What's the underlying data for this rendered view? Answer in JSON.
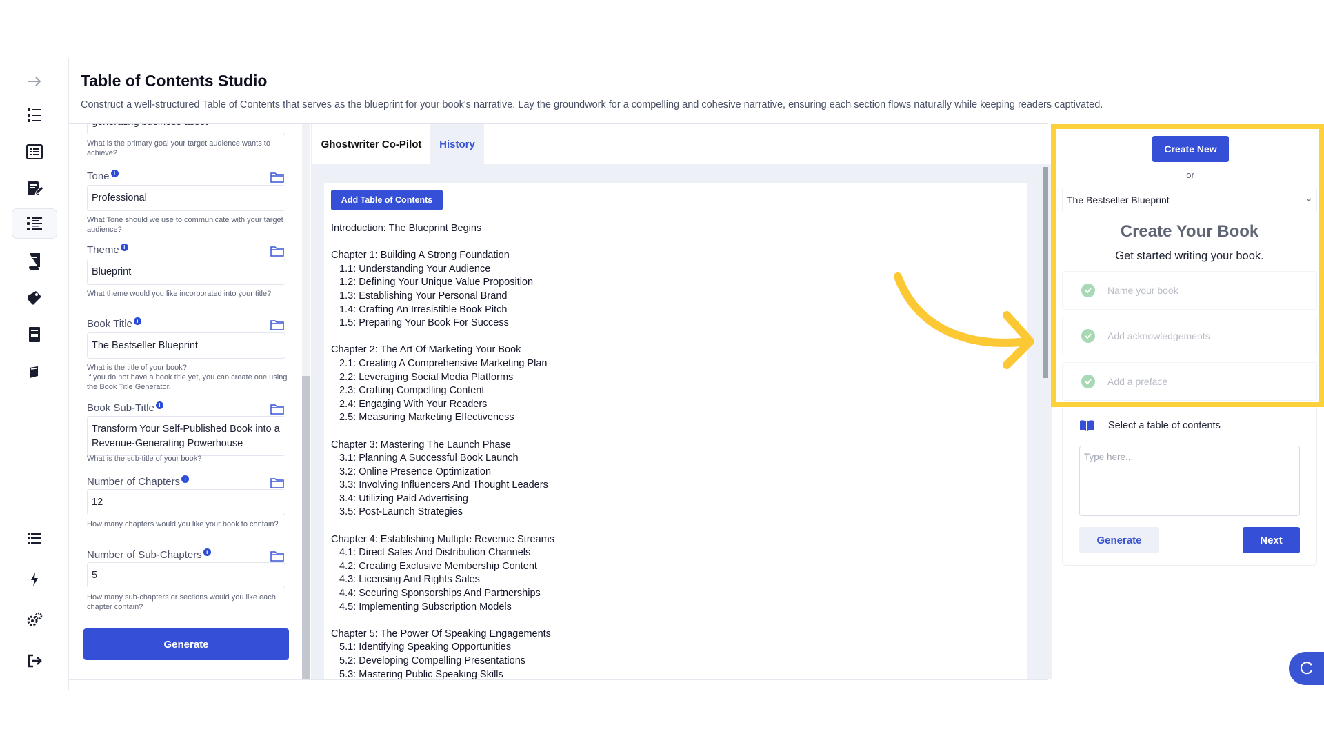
{
  "header": {
    "title": "Table of Contents Studio",
    "description": "Construct a well-structured Table of Contents that serves as the blueprint for your book's narrative. Lay the groundwork for a compelling and cohesive narrative, ensuring each section flows naturally while keeping readers captivated."
  },
  "sidebar": {
    "icons": [
      "arrow-right-icon",
      "numbered-list-icon",
      "document-list-icon",
      "edit-document-icon",
      "table-of-contents-icon",
      "book-stack-icon",
      "book-tag-icon",
      "archive-book-icon",
      "closed-book-icon",
      "list-icon",
      "lightning-icon",
      "settings-icon",
      "logout-icon"
    ]
  },
  "form": {
    "top_partial_value": "generating business asset",
    "top_help": "What is the primary goal your target audience wants to achieve?",
    "fields": [
      {
        "label": "Tone",
        "value": "Professional",
        "help": "What Tone should we use to communicate with your target audience?"
      },
      {
        "label": "Theme",
        "value": "Blueprint",
        "help": "What theme would you like incorporated into your title?"
      },
      {
        "label": "Book Title",
        "value": "The Bestseller Blueprint",
        "help": "What is the title of your book?\nIf you do not have a book title yet, you can create one using the Book Title Generator."
      },
      {
        "label": "Book Sub-Title",
        "value": "Transform Your Self-Published Book into a Revenue-Generating Powerhouse",
        "help": "What is the sub-title of your book?"
      },
      {
        "label": "Number of Chapters",
        "value": "12",
        "help": "How many chapters would you like your book to contain?"
      },
      {
        "label": "Number of Sub-Chapters",
        "value": "5",
        "help": "How many sub-chapters or sections would you like each chapter contain?"
      }
    ],
    "info_glyph": "i",
    "generate_label": "Generate"
  },
  "center": {
    "tabs": [
      "Ghostwriter Co-Pilot",
      "History"
    ],
    "add_toc_label": "Add Table of Contents",
    "intro": "Introduction: The Blueprint Begins",
    "chapters": [
      {
        "title": "Chapter 1: Building A Strong Foundation",
        "subs": [
          "1.1: Understanding Your Audience",
          "1.2: Defining Your Unique Value Proposition",
          "1.3: Establishing Your Personal Brand",
          "1.4: Crafting An Irresistible Book Pitch",
          "1.5: Preparing Your Book For Success"
        ]
      },
      {
        "title": "Chapter 2: The Art Of Marketing Your Book",
        "subs": [
          "2.1: Creating A Comprehensive Marketing Plan",
          "2.2: Leveraging Social Media Platforms",
          "2.3: Crafting Compelling Content",
          "2.4: Engaging With Your Readers",
          "2.5: Measuring Marketing Effectiveness"
        ]
      },
      {
        "title": "Chapter 3: Mastering The Launch Phase",
        "subs": [
          "3.1: Planning A Successful Book Launch",
          "3.2: Online Presence Optimization",
          "3.3: Involving Influencers And Thought Leaders",
          "3.4: Utilizing Paid Advertising",
          "3.5: Post-Launch Strategies"
        ]
      },
      {
        "title": "Chapter 4: Establishing Multiple Revenue Streams",
        "subs": [
          "4.1: Direct Sales And Distribution Channels",
          "4.2: Creating Exclusive Membership Content",
          "4.3: Licensing And Rights Sales",
          "4.4: Securing Sponsorships And Partnerships",
          "4.5: Implementing Subscription Models"
        ]
      },
      {
        "title": "Chapter 5: The Power Of Speaking Engagements",
        "subs": [
          "5.1: Identifying Speaking Opportunities",
          "5.2: Developing Compelling Presentations",
          "5.3: Mastering Public Speaking Skills"
        ]
      }
    ]
  },
  "right": {
    "create_new_label": "Create New",
    "or_label": "or",
    "selected_book": "The Bestseller Blueprint",
    "title": "Create Your Book",
    "subtitle": "Get started writing your book.",
    "steps": [
      "Name your book",
      "Add acknowledgements",
      "Add a preface"
    ],
    "select_toc_label": "Select a table of contents",
    "textarea_placeholder": "Type here...",
    "generate_label": "Generate",
    "next_label": "Next"
  },
  "colors": {
    "primary": "#3550d6",
    "highlight": "#fdd13a",
    "check_green": "#a8d9b4"
  }
}
